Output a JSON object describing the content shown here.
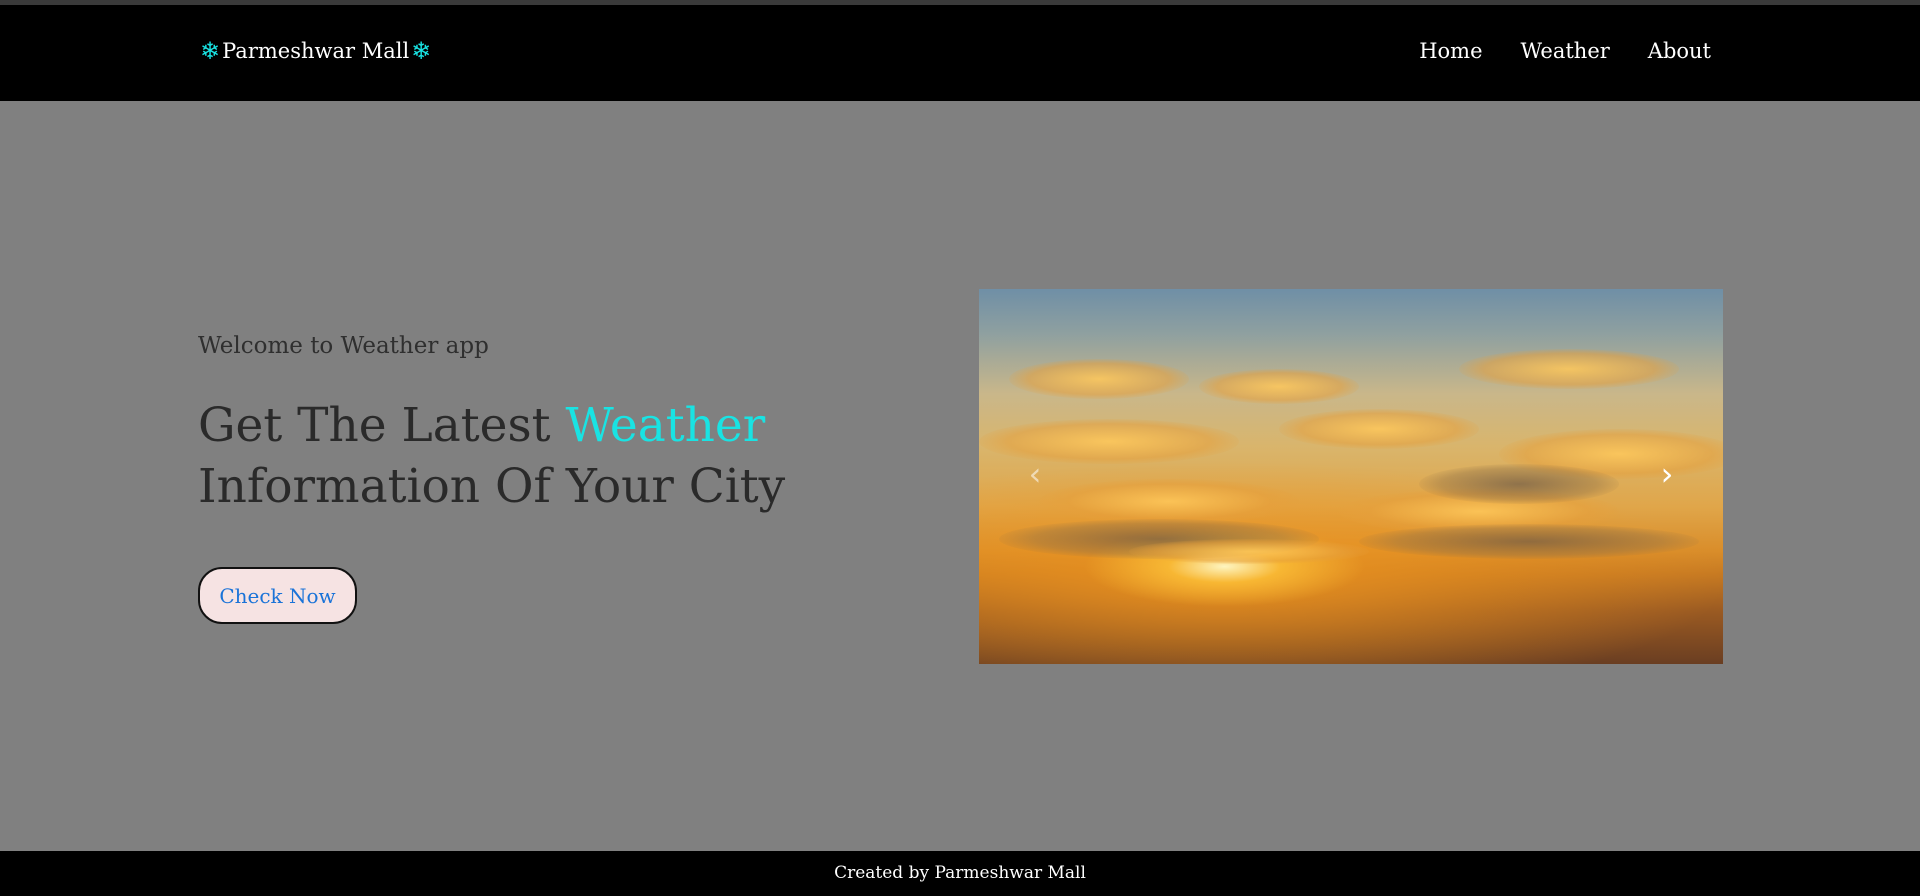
{
  "brand": {
    "name": "Parmeshwar Mall",
    "icon_left": "❄",
    "icon_right": "❄",
    "icon_color": "#19e3e3"
  },
  "nav": {
    "items": [
      "Home",
      "Weather",
      "About"
    ]
  },
  "hero": {
    "welcome": "Welcome to Weather app",
    "headline_pre": "Get The Latest ",
    "headline_accent": "Weather",
    "headline_post": "Information Of Your City",
    "accent_color": "#19e3e3",
    "cta_label": "Check Now"
  },
  "carousel": {
    "prev_icon": "‹",
    "next_icon": "›",
    "image_subject": "sunset-over-clouds"
  },
  "footer": {
    "text": "Created by Parmeshwar Mall"
  }
}
